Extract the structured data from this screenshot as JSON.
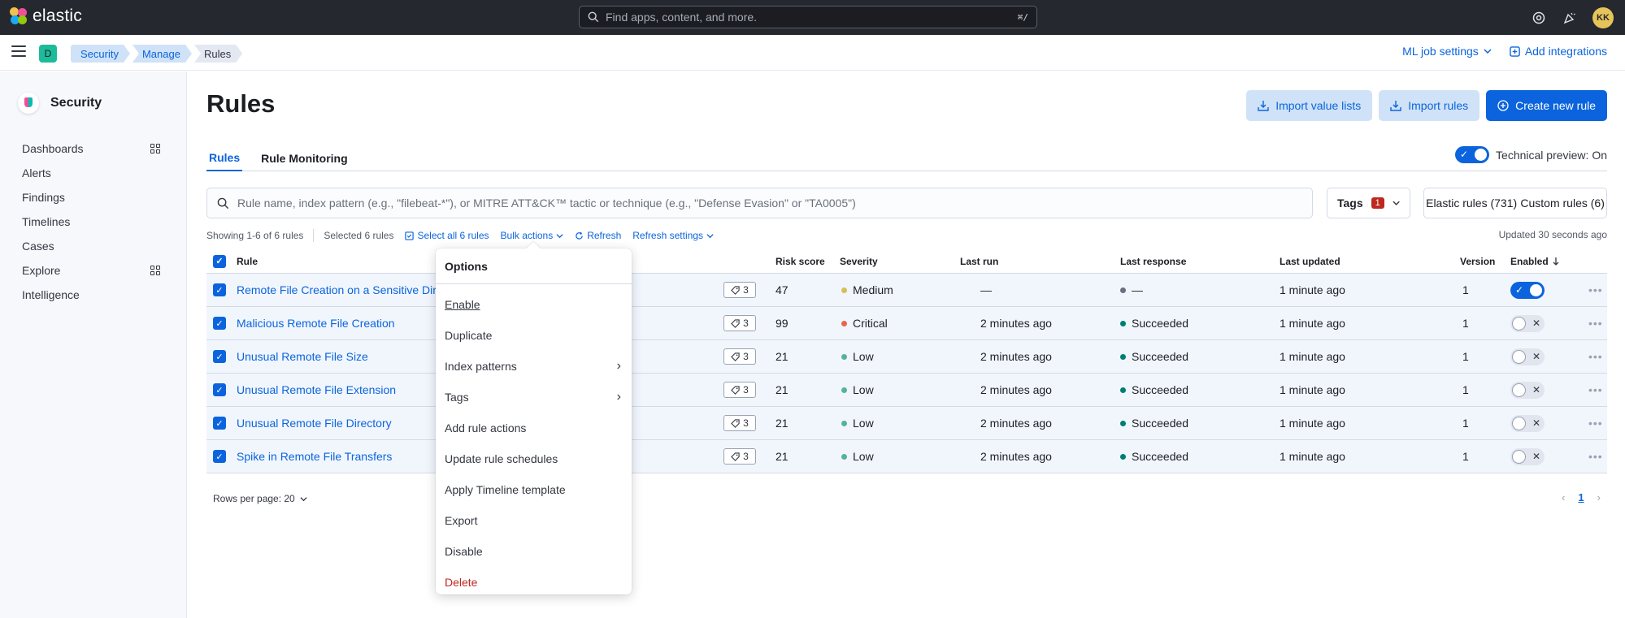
{
  "header": {
    "logo_text": "elastic",
    "search_placeholder": "Find apps, content, and more.",
    "search_shortcut": "⌘/",
    "avatar_initials": "KK"
  },
  "subheader": {
    "space_letter": "D",
    "breadcrumbs": [
      "Security",
      "Manage",
      "Rules"
    ],
    "ml_settings": "ML job settings",
    "add_integrations": "Add integrations"
  },
  "sidebar": {
    "title": "Security",
    "items": [
      {
        "label": "Dashboards",
        "has_grid": true
      },
      {
        "label": "Alerts",
        "has_grid": false
      },
      {
        "label": "Findings",
        "has_grid": false
      },
      {
        "label": "Timelines",
        "has_grid": false
      },
      {
        "label": "Cases",
        "has_grid": false
      },
      {
        "label": "Explore",
        "has_grid": true
      },
      {
        "label": "Intelligence",
        "has_grid": false
      }
    ]
  },
  "page": {
    "title": "Rules",
    "import_value_lists": "Import value lists",
    "import_rules": "Import rules",
    "create_rule": "Create new rule",
    "tabs": [
      "Rules",
      "Rule Monitoring"
    ],
    "preview_label": "Technical preview: On",
    "search_placeholder": "Rule name, index pattern (e.g., \"filebeat-*\"), or MITRE ATT&CK™ tactic or technique (e.g., \"Defense Evasion\" or \"TA0005\")",
    "tags_label": "Tags",
    "tags_count": "1",
    "elastic_rules": "Elastic rules (731)",
    "custom_rules": "Custom rules (6)",
    "showing": "Showing 1-6 of 6 rules",
    "selected": "Selected 6 rules",
    "select_all": "Select all 6 rules",
    "bulk_actions": "Bulk actions",
    "refresh": "Refresh",
    "refresh_settings": "Refresh settings",
    "updated": "Updated 30 seconds ago",
    "rows_per_page": "Rows per page: 20",
    "current_page": "1"
  },
  "table": {
    "columns": {
      "rule": "Rule",
      "risk": "Risk score",
      "severity": "Severity",
      "last_run": "Last run",
      "last_response": "Last response",
      "last_updated": "Last updated",
      "version": "Version",
      "enabled": "Enabled"
    },
    "rows": [
      {
        "name": "Remote File Creation on a Sensitive Directory",
        "tags": "3",
        "risk": "47",
        "severity": "Medium",
        "severity_color": "#d6bf57",
        "last_run": "—",
        "response": "—",
        "response_color": "#69707d",
        "updated": "1 minute ago",
        "version": "1",
        "enabled": true
      },
      {
        "name": "Malicious Remote File Creation",
        "tags": "3",
        "risk": "99",
        "severity": "Critical",
        "severity_color": "#e7664c",
        "last_run": "2 minutes ago",
        "response": "Succeeded",
        "response_color": "#017d73",
        "updated": "1 minute ago",
        "version": "1",
        "enabled": false
      },
      {
        "name": "Unusual Remote File Size",
        "tags": "3",
        "risk": "21",
        "severity": "Low",
        "severity_color": "#54b399",
        "last_run": "2 minutes ago",
        "response": "Succeeded",
        "response_color": "#017d73",
        "updated": "1 minute ago",
        "version": "1",
        "enabled": false
      },
      {
        "name": "Unusual Remote File Extension",
        "tags": "3",
        "risk": "21",
        "severity": "Low",
        "severity_color": "#54b399",
        "last_run": "2 minutes ago",
        "response": "Succeeded",
        "response_color": "#017d73",
        "updated": "1 minute ago",
        "version": "1",
        "enabled": false
      },
      {
        "name": "Unusual Remote File Directory",
        "tags": "3",
        "risk": "21",
        "severity": "Low",
        "severity_color": "#54b399",
        "last_run": "2 minutes ago",
        "response": "Succeeded",
        "response_color": "#017d73",
        "updated": "1 minute ago",
        "version": "1",
        "enabled": false
      },
      {
        "name": "Spike in Remote File Transfers",
        "tags": "3",
        "risk": "21",
        "severity": "Low",
        "severity_color": "#54b399",
        "last_run": "2 minutes ago",
        "response": "Succeeded",
        "response_color": "#017d73",
        "updated": "1 minute ago",
        "version": "1",
        "enabled": false
      }
    ]
  },
  "bulk_menu": {
    "title": "Options",
    "items": [
      {
        "label": "Enable",
        "submenu": false,
        "danger": false,
        "focused": true
      },
      {
        "label": "Duplicate",
        "submenu": false,
        "danger": false,
        "focused": false
      },
      {
        "label": "Index patterns",
        "submenu": true,
        "danger": false,
        "focused": false
      },
      {
        "label": "Tags",
        "submenu": true,
        "danger": false,
        "focused": false
      },
      {
        "label": "Add rule actions",
        "submenu": false,
        "danger": false,
        "focused": false
      },
      {
        "label": "Update rule schedules",
        "submenu": false,
        "danger": false,
        "focused": false
      },
      {
        "label": "Apply Timeline template",
        "submenu": false,
        "danger": false,
        "focused": false
      },
      {
        "label": "Export",
        "submenu": false,
        "danger": false,
        "focused": false
      },
      {
        "label": "Disable",
        "submenu": false,
        "danger": false,
        "focused": false
      },
      {
        "label": "Delete",
        "submenu": false,
        "danger": true,
        "focused": false
      }
    ]
  }
}
